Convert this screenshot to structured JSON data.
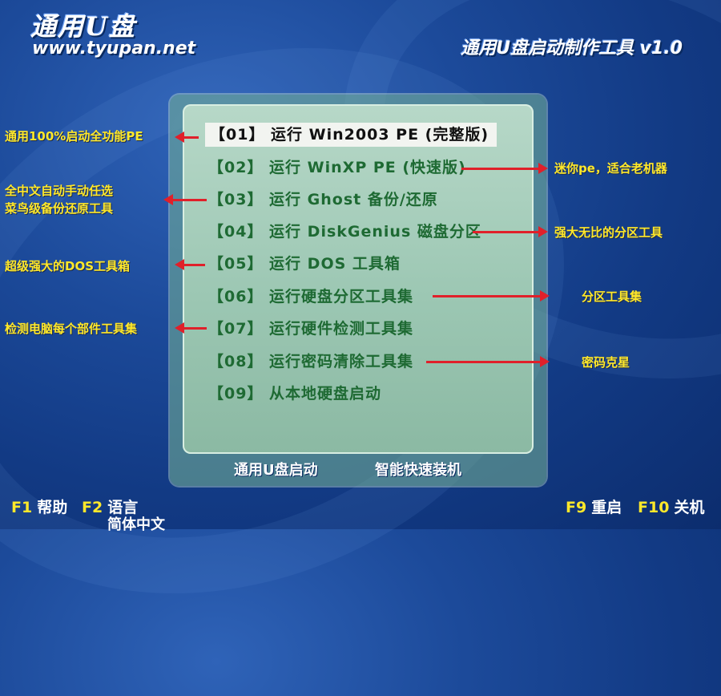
{
  "header": {
    "brand": "通用U盘",
    "url": "www.tyupan.net",
    "product": "通用U盘启动制作工具 v1.0"
  },
  "menu": {
    "items": [
      {
        "label": "【01】 运行 Win2003 PE (完整版)",
        "selected": true
      },
      {
        "label": "【02】 运行 WinXP PE (快速版)"
      },
      {
        "label": "【03】 运行 Ghost 备份/还原"
      },
      {
        "label": "【04】 运行 DiskGenius 磁盘分区"
      },
      {
        "label": "【05】 运行 DOS 工具箱"
      },
      {
        "label": "【06】 运行硬盘分区工具集"
      },
      {
        "label": "【07】 运行硬件检测工具集"
      },
      {
        "label": "【08】 运行密码清除工具集"
      },
      {
        "label": "【09】 从本地硬盘启动"
      }
    ],
    "footer_left": "通用U盘启动",
    "footer_right": "智能快速装机"
  },
  "annotations": {
    "a1": "通用100%启动全功能PE",
    "a2": "迷你pe，适合老机器",
    "a3_line1": "全中文自动手动任选",
    "a3_line2": "菜鸟级备份还原工具",
    "a4": "强大无比的分区工具",
    "a5": "超级强大的DOS工具箱",
    "a6": "分区工具集",
    "a7": "检测电脑每个部件工具集",
    "a8": "密码克星"
  },
  "function_keys": {
    "f1_key": "F1",
    "f1_label": "帮助",
    "f2_key": "F2",
    "f2_label": "语言",
    "language_current": "简体中文",
    "f9_key": "F9",
    "f9_label": "重启",
    "f10_key": "F10",
    "f10_label": "关机"
  },
  "colors": {
    "annotation": "#ffe82a",
    "arrow": "#e0202a",
    "menu_text": "#1e6a33"
  }
}
